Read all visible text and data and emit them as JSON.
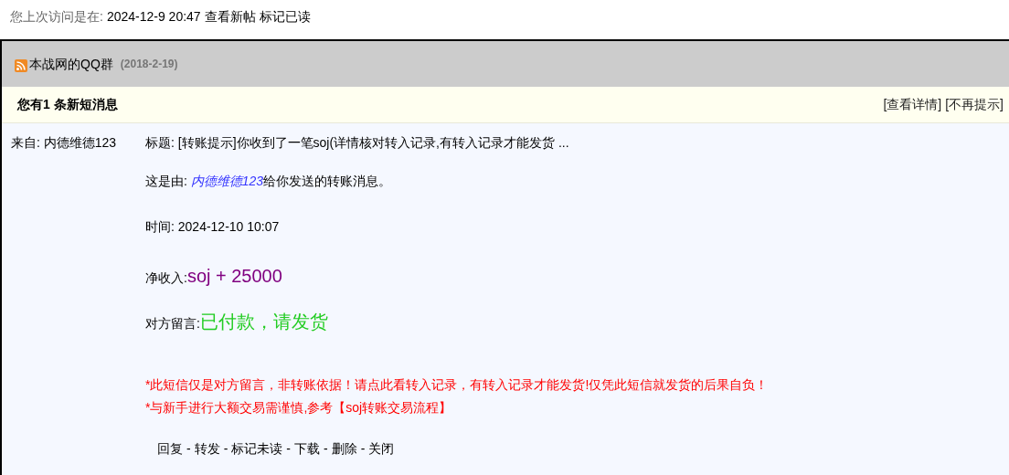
{
  "last_visit": {
    "label": "您上次访问是在:",
    "time": "2024-12-9 20:47",
    "links": [
      "查看新帖",
      "标记已读"
    ]
  },
  "announcement": {
    "title": "本战网的QQ群",
    "date": "(2018-2-19)"
  },
  "notice": {
    "title": "您有1 条新短消息",
    "links": [
      "[查看详情]",
      "[不再提示]"
    ]
  },
  "message": {
    "from": "来自: 内德维德123",
    "subject": "标题: [转账提示]你收到了一笔soj(详情核对转入记录,有转入记录才能发货 ...",
    "sender_prefix": "这是由: ",
    "sender": "内德维德123",
    "sender_suffix": "给你发送的转账消息。",
    "time": "时间: 2024-12-10 10:07",
    "income_label": "净收入:",
    "income": "soj + 25000",
    "note_label": "对方留言:",
    "note": "已付款，请发货",
    "warnings": [
      "*此短信仅是对方留言，非转账依据！请点此看转入记录，有转入记录才能发货!仅凭此短信就发货的后果自负！",
      "*与新手进行大额交易需谨慎,参考【soj转账交易流程】"
    ],
    "actions": [
      "回复",
      "转发",
      "标记未读",
      "下载",
      "删除",
      "关闭"
    ],
    "separator": "-"
  }
}
